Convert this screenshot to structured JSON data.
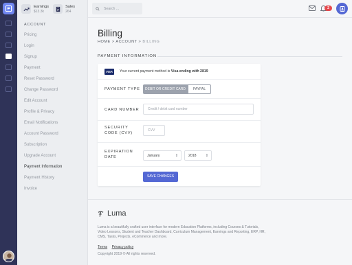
{
  "header": {
    "stats": [
      {
        "label": "Earnings",
        "value": "$13.3k",
        "icon": "trending-up-icon"
      },
      {
        "label": "Sales",
        "value": "264",
        "icon": "receipt-icon"
      }
    ],
    "search_placeholder": "Search ...",
    "notification_count": "2"
  },
  "sidebar": {
    "heading": "ACCOUNT",
    "items": [
      {
        "label": "Pricing"
      },
      {
        "label": "Login"
      },
      {
        "label": "Signup"
      },
      {
        "label": "Payment"
      },
      {
        "label": "Reset Password"
      },
      {
        "label": "Change Password"
      },
      {
        "label": "Edit Account"
      },
      {
        "label": "Profile & Privacy"
      },
      {
        "label": "Email Notifications"
      },
      {
        "label": "Account Password"
      },
      {
        "label": "Subscription"
      },
      {
        "label": "Upgrade Account"
      },
      {
        "label": "Payment Information",
        "active": true
      },
      {
        "label": "Payment History"
      },
      {
        "label": "Invoice"
      }
    ]
  },
  "page": {
    "title": "Billing",
    "breadcrumb": {
      "home": "HOME",
      "sep": ">",
      "account": "ACCOUNT",
      "current": "BILLING"
    },
    "section_title": "PAYMENT INFORMATION"
  },
  "form": {
    "card_brand": "VISA",
    "current_method_prefix": "Your current payment method is ",
    "current_method_value": "Visa ending with 2819",
    "payment_type_label": "PAYMENT TYPE",
    "payment_type_options": [
      "DEBIT OR CREDIT CARD",
      "PAYPAL"
    ],
    "payment_type_selected": "DEBIT OR CREDIT CARD",
    "card_number_label": "CARD NUMBER",
    "card_number_placeholder": "Credit / debit card number",
    "security_label_1": "SECURITY",
    "security_label_2": "CODE (CVV)",
    "cvv_placeholder": "CVV",
    "expiration_label_1": "EXPIRATION",
    "expiration_label_2": "DATE",
    "month": "January",
    "year": "2018",
    "save_label": "SAVE CHANGES"
  },
  "footer": {
    "brand": "Luma",
    "description": "Luma is a beautifully crafted user interface for modern Education Platforms, including Courses & Tutorials, Video Lessons, Student and Teacher Dashboard, Curriculum Management, Earnings and Reporting, ERP, HR, CMS, Tasks, Projects, eCommerce and more.",
    "links": [
      "Terms",
      "Privacy policy"
    ],
    "copyright": "Copyright 2019 © All rights reserved."
  }
}
